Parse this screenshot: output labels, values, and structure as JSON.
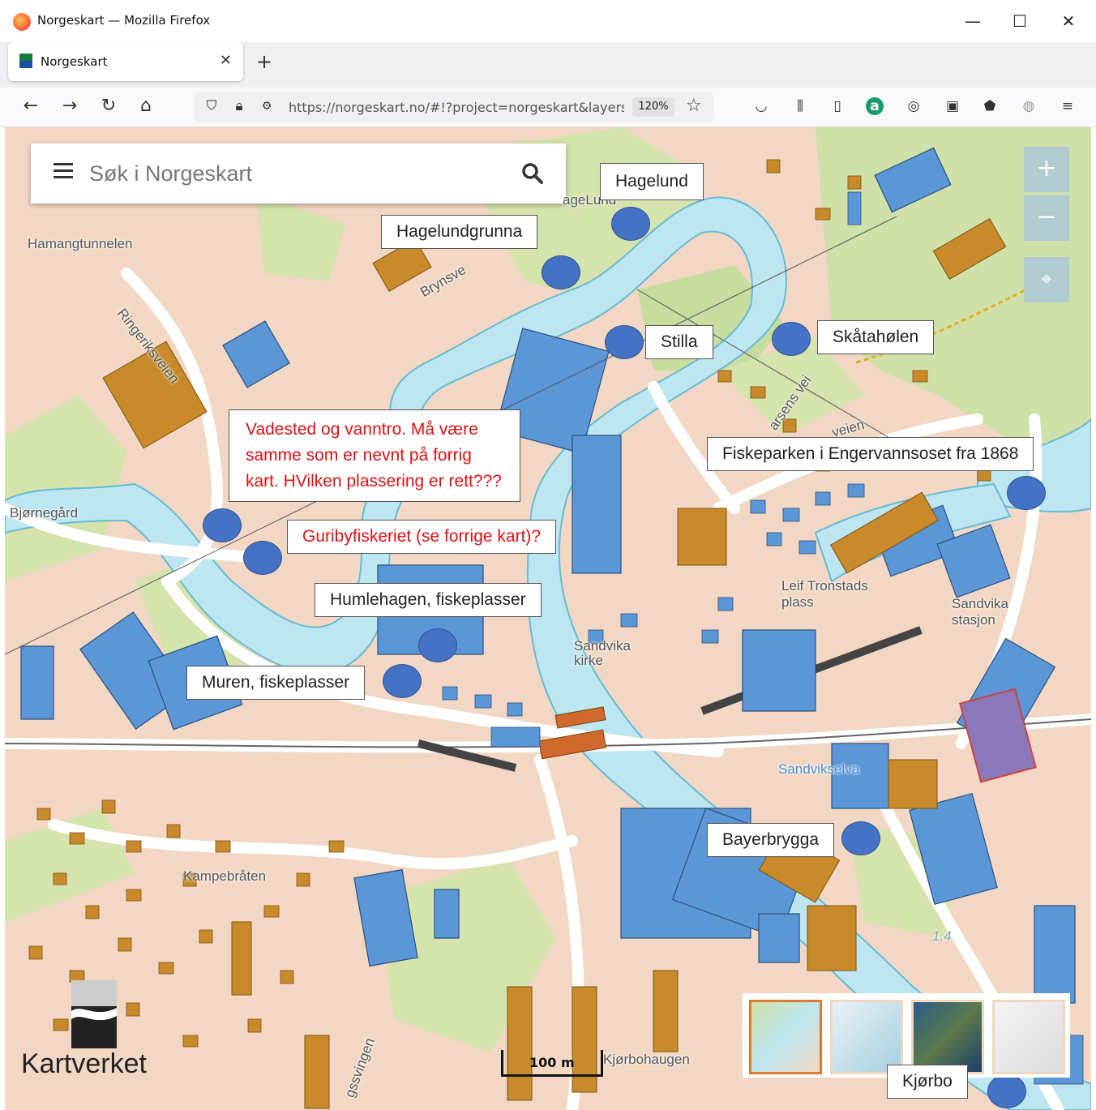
{
  "window": {
    "title": "Norgeskart — Mozilla Firefox"
  },
  "tabs": [
    {
      "label": "Norgeskart"
    }
  ],
  "navbar": {
    "url": "https://norgeskart.no/#!?project=norgeskart&layers",
    "zoom": "120%"
  },
  "search": {
    "placeholder": "Søk i Norgeskart"
  },
  "zoom_controls": {
    "plus": "+",
    "minus": "−"
  },
  "annotations": [
    {
      "text": "Hagelund"
    },
    {
      "text": "Hagelundgrunna"
    },
    {
      "text": "Stilla"
    },
    {
      "text": "Skåtahølen"
    },
    {
      "text": "Fiskeparken i Engervannsoset fra 1868"
    },
    {
      "text": "Vadested og vanntro. Må være\nsamme som er nevnt på forrig\nkart. HVilken plassering er rett???"
    },
    {
      "text": "Guribyfiskeriet (se forrige kart)?"
    },
    {
      "text": "Humlehagen, fiskeplasser"
    },
    {
      "text": "Muren, fiskeplasser"
    },
    {
      "text": "Bayerbrygga"
    },
    {
      "text": "Kjørbo"
    }
  ],
  "map_labels": {
    "hamangtunnelen": "Hamangtunnelen",
    "ringeriksveien": "Ringeriksveien",
    "bjornegard": "Bjørnegård",
    "brynsveien": "Brynsve",
    "hagelund": "ageLund",
    "larsens_vei": "arsens vei",
    "veien": "veien",
    "leif_tronstads": "Leif Tronstads",
    "plass": "plass",
    "sandvika_stasjon_1": "Sandvika",
    "sandvika_stasjon_2": "stasjon",
    "sandvika_kirke_1": "Sandvika",
    "sandvika_kirke_2": "kirke",
    "sandvikselva": "Sandvikselva",
    "kampebraten": "Kampebråten",
    "kjorbohaugen": "Kjørbohaugen",
    "depth": "1.4",
    "svingen": "gssvingen"
  },
  "scale": {
    "label": "100 m"
  },
  "brand": {
    "name": "Kartverket"
  }
}
